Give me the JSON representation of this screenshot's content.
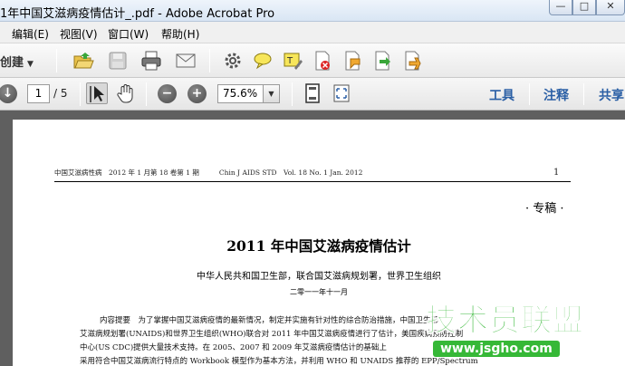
{
  "window": {
    "title": "1年中国艾滋病疫情估计_.pdf - Adobe Acrobat Pro",
    "min_label": "—",
    "max_label": "□",
    "close_label": "✕"
  },
  "menu": [
    "编辑(E)",
    "视图(V)",
    "窗口(W)",
    "帮助(H)"
  ],
  "toolbar": {
    "create_label": "创建",
    "icons": [
      "open-icon",
      "save-icon",
      "print-icon",
      "email-icon",
      "gear-icon",
      "comment-icon",
      "highlight-icon",
      "document-icon-1",
      "document-icon-2",
      "document-icon-3",
      "document-icon-4"
    ]
  },
  "navbar": {
    "current_page": "1",
    "total_pages": "/ 5",
    "zoom": "75.6%",
    "tools_label": "工具",
    "comment_label": "注释",
    "share_label": "共享"
  },
  "document": {
    "running_head_cn": "中国艾滋病性病　2012 年 1 月第 18 卷第 1 期",
    "running_head_en": "Chin J AIDS STD　Vol. 18 No. 1 Jan. 2012",
    "page_number": "1",
    "column_label": "· 专稿 ·",
    "title": "2011 年中国艾滋病疫情估计",
    "authors": "中华人民共和国卫生部，联合国艾滋病规划署，世界卫生组织",
    "date": "二零一一年十一月",
    "abstract_lines": [
      "内容提要　为了掌握中国艾滋病疫情的最新情况，制定并实施有针对性的综合防治措施，中国卫生部",
      "艾滋病规划署(UNAIDS)和世界卫生组织(WHO)联合对 2011 年中国艾滋病疫情进行了估计，美国疾病预防控制",
      "中心(US CDC)提供大量技术支持。在 2005、2007 和 2009 年艾滋病疫情估计的基础上",
      "采用符合中国艾滋病流行特点的 Workbook 模型作为基本方法，并利用 WHO 和 UNAIDS 推荐的 EPP/Spectrum"
    ]
  },
  "watermark": {
    "text": "技术员联盟",
    "url": "www.jsgho.com"
  }
}
